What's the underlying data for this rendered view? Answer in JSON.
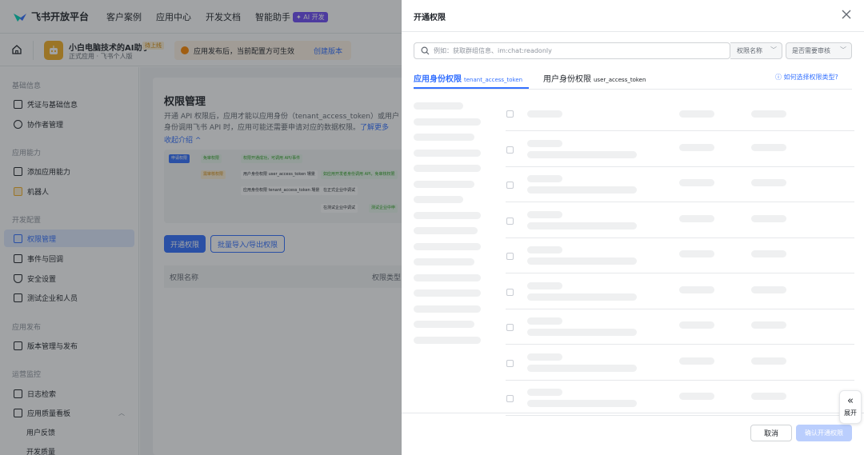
{
  "topnav": {
    "brand": "飞书开放平台",
    "items": [
      "客户案例",
      "应用中心",
      "开发文档",
      "智能助手"
    ],
    "ai_badge": "AI 开发"
  },
  "app": {
    "name": "小白电脑技术的AI助手",
    "status_tag": "待上线",
    "subtitle": "正式应用 · 飞书个人版",
    "notice": "应用发布后，当前配置方可生效",
    "notice_link": "创建版本"
  },
  "sidebar": {
    "groups": [
      "基础信息",
      "应用能力",
      "开发配置",
      "应用发布",
      "运营监控"
    ],
    "items": [
      {
        "label": "凭证与基础信息"
      },
      {
        "label": "协作者管理"
      },
      {
        "label": "添加应用能力"
      },
      {
        "label": "机器人"
      },
      {
        "label": "权限管理"
      },
      {
        "label": "事件与回调"
      },
      {
        "label": "安全设置"
      },
      {
        "label": "测试企业和人员"
      },
      {
        "label": "版本管理与发布"
      },
      {
        "label": "日志检索"
      },
      {
        "label": "应用质量看板"
      },
      {
        "label": "用户反馈"
      },
      {
        "label": "开发质量"
      }
    ]
  },
  "main": {
    "title": "权限管理",
    "desc": "开通 API 权限后，应用才能以应用身份（tenant_access_token）或用户身份调用飞书 API 时，应用可能还需要申请对应的数据权限。",
    "learn_more": "了解更多",
    "collapse": "收起介绍 ^",
    "diagram": {
      "b1": "申请权限",
      "b2": "免审权限",
      "b3": "权限开通成功，可调用 API/事件",
      "b4": "需审核权限",
      "b5": "用户身份权限 user_access_token 場景",
      "b6": "如应用开发者身份调用 API，免审核权限",
      "b7": "应用身份权限 tenant_access_token 場景",
      "b8": "在正式企业中调试",
      "b9": "在测试企业中调试",
      "b10": "测试企业中申"
    },
    "btn_open": "开通权限",
    "btn_batch": "批量导入/导出权限",
    "col_name": "权限名称",
    "col_type": "权限类型"
  },
  "drawer": {
    "title": "开通权限",
    "search_placeholder": "例如：获取群组信息、im:chat:readonly",
    "select_name": "权限名称",
    "select_review": "是否需要审核",
    "tab1": "应用身份权限",
    "tab1_token": "tenant_access_token",
    "tab2": "用户身份权限",
    "tab2_token": "user_access_token",
    "help": "如何选择权限类型?",
    "cancel": "取消",
    "confirm": "确认开通权限"
  },
  "expand_button": {
    "label": "展开"
  },
  "colors": {
    "primary": "#3370ff",
    "active_bg": "#e1eaff",
    "warning": "#ff8800",
    "confirm_disabled": "#bacefd"
  }
}
